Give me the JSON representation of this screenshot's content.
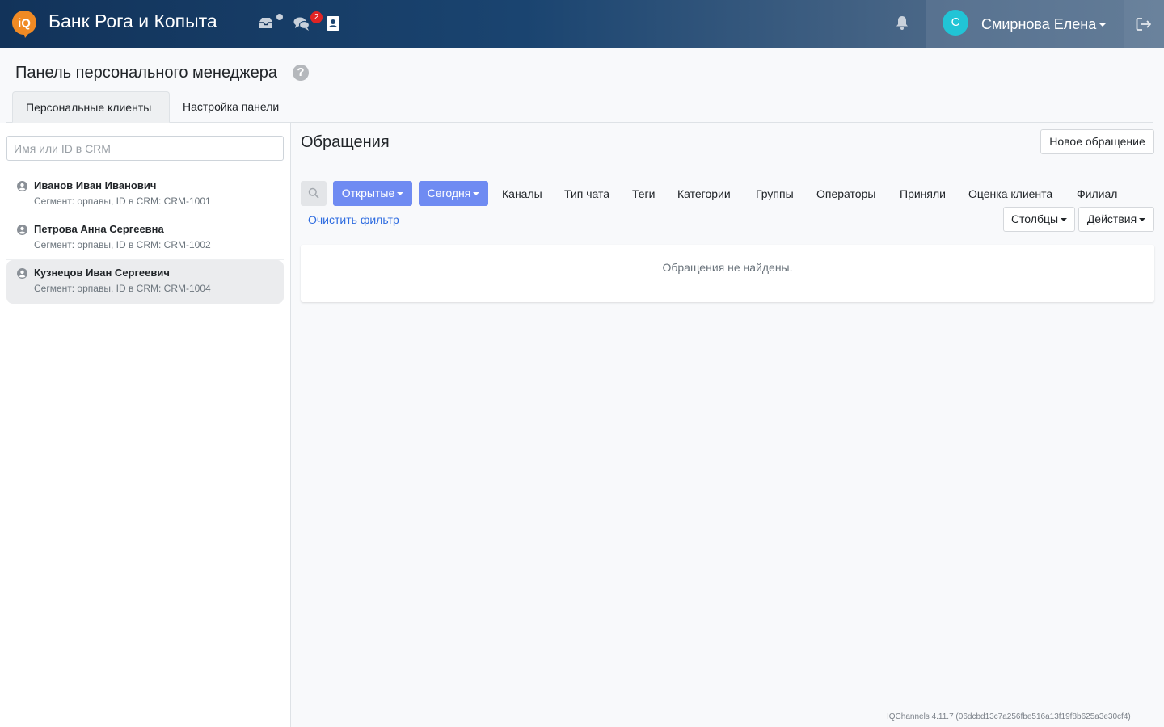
{
  "header": {
    "brand": "Банк Рога и Копыта",
    "logo_text": "iQ",
    "chats_badge": "2",
    "avatar_initial": "С",
    "user_name": "Смирнова Елена"
  },
  "page": {
    "title": "Панель персонального менеджера",
    "tabs": [
      {
        "label": "Персональные клиенты",
        "active": true
      },
      {
        "label": "Настройка панели",
        "active": false
      }
    ]
  },
  "sidebar": {
    "search_placeholder": "Имя или ID в CRM",
    "clients": [
      {
        "name": "Иванов Иван Иванович",
        "info": "Сегмент: орпавы, ID в CRM: CRM-1001"
      },
      {
        "name": "Петрова Анна Сергеевна",
        "info": "Сегмент: орпавы, ID в CRM: CRM-1002"
      },
      {
        "name": "Кузнецов Иван Сергеевич",
        "info": "Сегмент: орпавы, ID в CRM: CRM-1004"
      }
    ]
  },
  "main": {
    "title": "Обращения",
    "new_button": "Новое обращение",
    "status_dropdown": "Открытые",
    "date_dropdown": "Сегодня",
    "filters": [
      "Каналы",
      "Тип чата",
      "Теги",
      "Категории",
      "Группы",
      "Операторы",
      "Приняли",
      "Оценка клиента",
      "Филиал"
    ],
    "clear_filter": "Очистить фильтр",
    "columns_button": "Столбцы",
    "actions_button": "Действия",
    "empty_message": "Обращения не найдены."
  },
  "footer": {
    "version": "IQChannels 4.11.7 (06dcbd13c7a256fbe516a13f19f8b625a3e30cf4)"
  },
  "colors": {
    "primary_button": "#6f8bf2",
    "avatar": "#21c4d6",
    "badge": "#e02424",
    "logo": "#f08a24"
  }
}
